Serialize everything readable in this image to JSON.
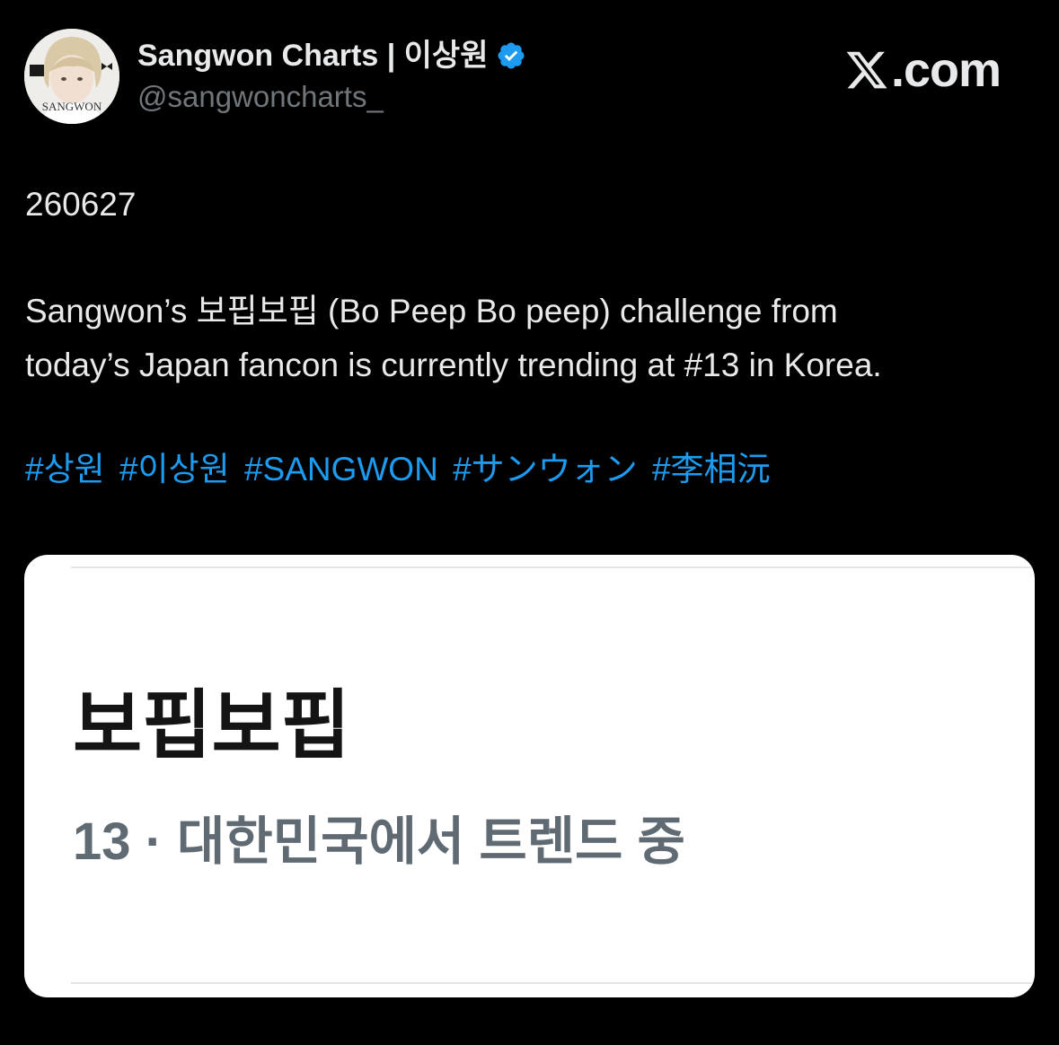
{
  "author": {
    "display_name": "Sangwon Charts | 이상원",
    "handle": "@sangwoncharts_",
    "verified": true,
    "verified_color": "#1d9bf0",
    "avatar_icon": "profile-photo"
  },
  "site": {
    "logo_icon": "x-logo",
    "domain": ".com"
  },
  "tweet": {
    "date": "260627",
    "body_line1": "Sangwon’s 보핍보핍 (Bo Peep Bo peep) challenge from",
    "body_line2": "today’s Japan fancon is currently trending at #13 in Korea.",
    "hashtags": [
      "#상원",
      "#이상원",
      "#SANGWON",
      "#サンウォン",
      "#李相沅"
    ],
    "hashtag_color": "#1d9bf0"
  },
  "media": {
    "trend_term": "보핍보핍",
    "trend_meta": "13 · 대한민국에서 트렌드 중"
  }
}
